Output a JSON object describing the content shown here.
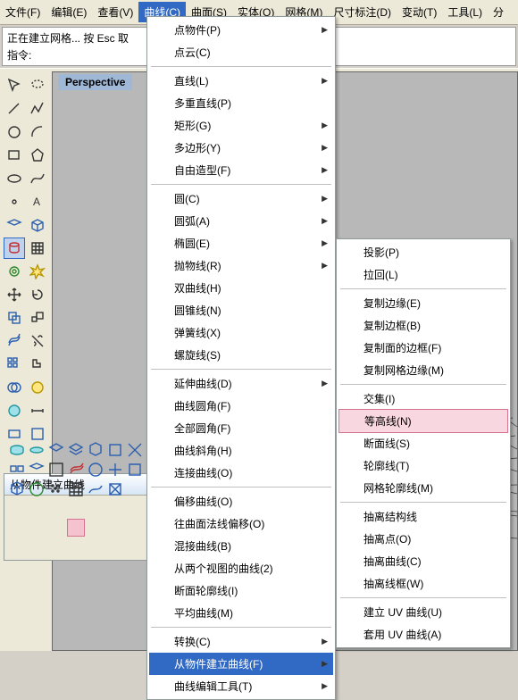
{
  "menubar": [
    "文件(F)",
    "编辑(E)",
    "查看(V)",
    "曲线(C)",
    "曲面(S)",
    "实体(O)",
    "网格(M)",
    "尺寸标注(D)",
    "变动(T)",
    "工具(L)",
    "分"
  ],
  "menubar_active_index": 3,
  "status": {
    "line1": "正在建立网格... 按 Esc 取",
    "prompt_label": "指令:"
  },
  "viewport": {
    "title": "Perspective"
  },
  "panel": {
    "title": "从物件建立曲线"
  },
  "menu_curve": {
    "g1": [
      "点物件(P)",
      "点云(C)"
    ],
    "g2": [
      "直线(L)",
      "多重直线(P)",
      "矩形(G)",
      "多边形(Y)",
      "自由造型(F)"
    ],
    "g3": [
      "圆(C)",
      "圆弧(A)",
      "椭圆(E)",
      "抛物线(R)",
      "双曲线(H)",
      "圆锥线(N)",
      "弹簧线(X)",
      "螺旋线(S)"
    ],
    "g4": [
      "延伸曲线(D)",
      "曲线圆角(F)",
      "全部圆角(F)",
      "曲线斜角(H)",
      "连接曲线(O)"
    ],
    "g5": [
      "偏移曲线(O)",
      "往曲面法线偏移(O)",
      "混接曲线(B)",
      "从两个视图的曲线(2)",
      "断面轮廓线(I)",
      "平均曲线(M)"
    ],
    "g6": [
      "转换(C)",
      "从物件建立曲线(F)",
      "曲线编辑工具(T)"
    ],
    "arrows": [
      0,
      1,
      2,
      3,
      4,
      5,
      6,
      7,
      16,
      27,
      28,
      29
    ],
    "hl": "从物件建立曲线(F)"
  },
  "menu_sub": {
    "g1": [
      "投影(P)",
      "拉回(L)"
    ],
    "g2": [
      "复制边缘(E)",
      "复制边框(B)",
      "复制面的边框(F)",
      "复制网格边缘(M)"
    ],
    "g3": [
      "交集(I)",
      "等高线(N)",
      "断面线(S)",
      "轮廓线(T)",
      "网格轮廓线(M)"
    ],
    "g4": [
      "抽离结构线",
      "抽离点(O)",
      "抽离曲线(C)",
      "抽离线框(W)"
    ],
    "g5": [
      "建立 UV 曲线(U)",
      "套用 UV 曲线(A)"
    ],
    "hl": "等高线(N)"
  }
}
